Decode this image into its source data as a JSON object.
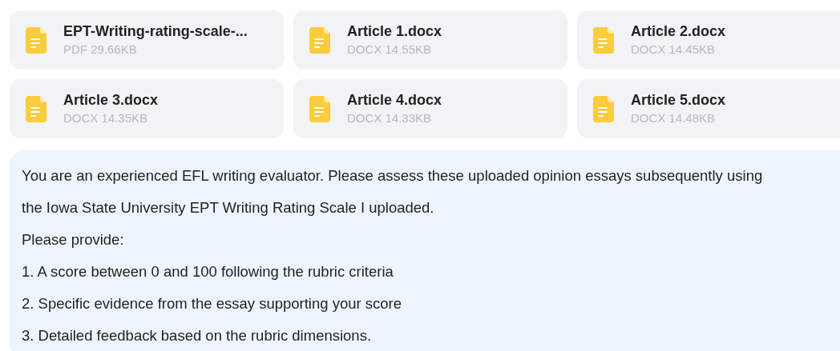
{
  "attachments": [
    {
      "name": "EPT-Writing-rating-scale-...",
      "meta": "PDF 29.66KB"
    },
    {
      "name": "Article 1.docx",
      "meta": "DOCX 14.55KB"
    },
    {
      "name": "Article 2.docx",
      "meta": "DOCX 14.45KB"
    },
    {
      "name": "Article 3.docx",
      "meta": "DOCX 14.35KB"
    },
    {
      "name": "Article 4.docx",
      "meta": "DOCX 14.33KB"
    },
    {
      "name": "Article 5.docx",
      "meta": "DOCX 14.48KB"
    }
  ],
  "message": {
    "lines": [
      "You are an experienced EFL writing evaluator. Please assess these uploaded opinion essays subsequently using the Iowa State University EPT Writing Rating Scale I uploaded.",
      "Please provide:",
      "1. A score between 0 and 100 following the rubric criteria",
      "2. Specific evidence from the essay supporting your score",
      "3. Detailed feedback based on the rubric dimensions."
    ]
  }
}
